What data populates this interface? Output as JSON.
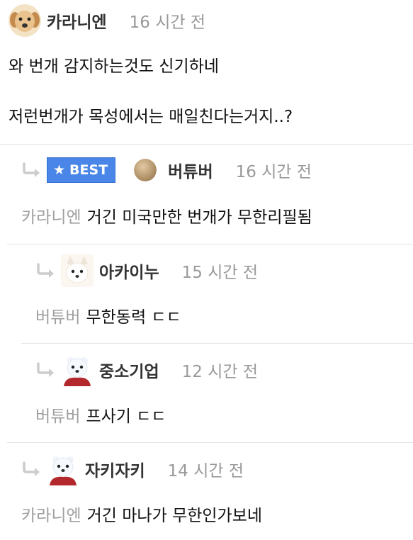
{
  "comments": [
    {
      "nickname": "카라니엔",
      "time": "16 시간 전",
      "lines": [
        "와 번개 감지하는것도 신기하네",
        "저런번개가 목성에서는 매일친다는거지..?"
      ]
    },
    {
      "badge": "BEST",
      "nickname": "버튜버",
      "time": "16 시간 전",
      "mention": "카라니엔",
      "text": "거긴 미국만한 번개가 무한리필됨"
    },
    {
      "nickname": "아카이누",
      "time": "15 시간 전",
      "mention": "버튜버",
      "text": "무한동력 ㄷㄷ"
    },
    {
      "nickname": "중소기업",
      "time": "12 시간 전",
      "mention": "버튜버",
      "text": "프사기 ㄷㄷ"
    },
    {
      "nickname": "자키자키",
      "time": "14 시간 전",
      "mention": "카라니엔",
      "text": "거긴 마나가 무한인가보네"
    }
  ],
  "icons": {
    "reply": "reply-arrow-icon",
    "badge": "star-icon"
  },
  "colors": {
    "badge_bg": "#4a86e8",
    "meta_gray": "#999999",
    "mention_gray": "#a0a0a0"
  }
}
